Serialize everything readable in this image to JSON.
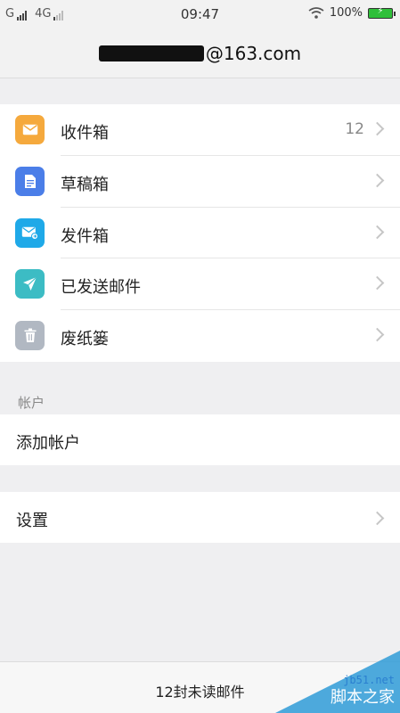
{
  "status_bar": {
    "carrier1": "G",
    "carrier2": "4G",
    "time": "09:47",
    "battery": "100%"
  },
  "header": {
    "email_suffix": "@163.com"
  },
  "mailboxes": [
    {
      "label": "收件箱",
      "count": "12",
      "icon": "inbox-icon",
      "color": "#f5a93d"
    },
    {
      "label": "草稿箱",
      "count": "",
      "icon": "draft-icon",
      "color": "#4b7ee8"
    },
    {
      "label": "发件箱",
      "count": "",
      "icon": "outbox-icon",
      "color": "#1fa9e8"
    },
    {
      "label": "已发送邮件",
      "count": "",
      "icon": "sent-icon",
      "color": "#3cbcc4"
    },
    {
      "label": "废纸篓",
      "count": "",
      "icon": "trash-icon",
      "color": "#b1b8c2"
    }
  ],
  "account_section": {
    "header": "帐户",
    "add_account": "添加帐户"
  },
  "settings": {
    "label": "设置"
  },
  "footer": {
    "unread_text": "12封未读邮件"
  },
  "watermark": {
    "site": "jb51.net",
    "name": "脚本之家"
  }
}
